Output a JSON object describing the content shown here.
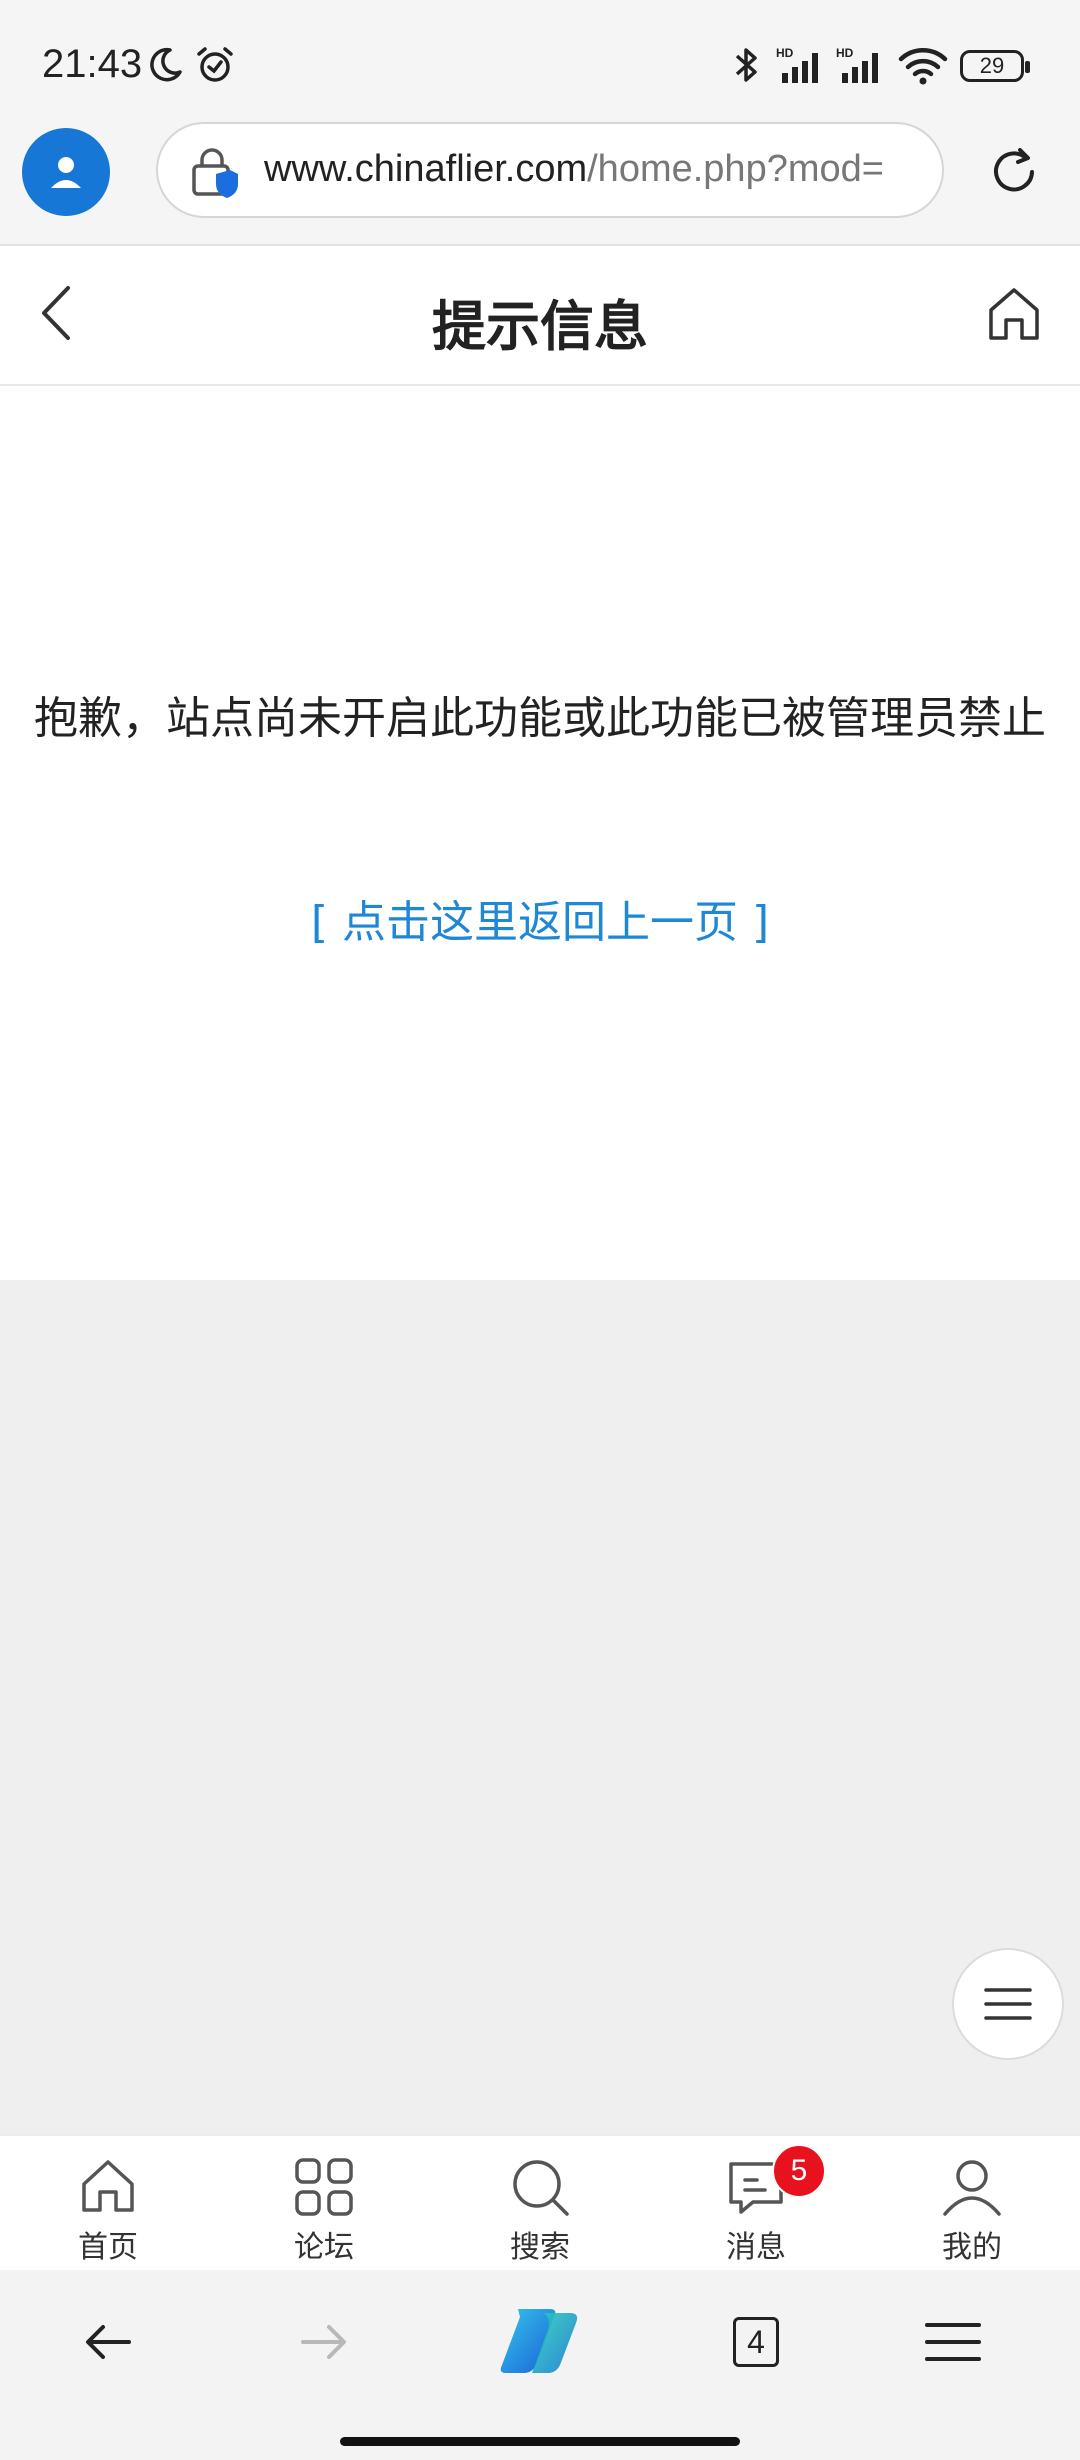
{
  "status_bar": {
    "time": "21:43",
    "battery": "29",
    "icons": [
      "moon-icon",
      "alarm-icon",
      "bluetooth-icon",
      "signal-hd-icon",
      "signal-hd-icon",
      "wifi-icon"
    ]
  },
  "browser": {
    "url_host": "www.chinaflier.com",
    "url_path": "/home.php?mod=",
    "icons": [
      "profile-icon",
      "secure-lock-icon",
      "reload-icon"
    ]
  },
  "page": {
    "title": "提示信息",
    "message": "抱歉，站点尚未开启此功能或此功能已被管理员禁止",
    "back_link": "[ 点击这里返回上一页 ]"
  },
  "site_nav": {
    "items": [
      {
        "label": "首页",
        "icon": "home-icon"
      },
      {
        "label": "论坛",
        "icon": "grid-icon"
      },
      {
        "label": "搜索",
        "icon": "search-icon"
      },
      {
        "label": "消息",
        "icon": "message-icon",
        "badge": "5"
      },
      {
        "label": "我的",
        "icon": "person-icon"
      }
    ]
  },
  "toolbar": {
    "tabs_count": "4",
    "icons": [
      "back-arrow-icon",
      "forward-arrow-icon",
      "copilot-icon",
      "tabs-icon",
      "menu-icon"
    ]
  },
  "colors": {
    "accent": "#1677d6",
    "link": "#1e87d6",
    "badge": "#e8121f"
  }
}
